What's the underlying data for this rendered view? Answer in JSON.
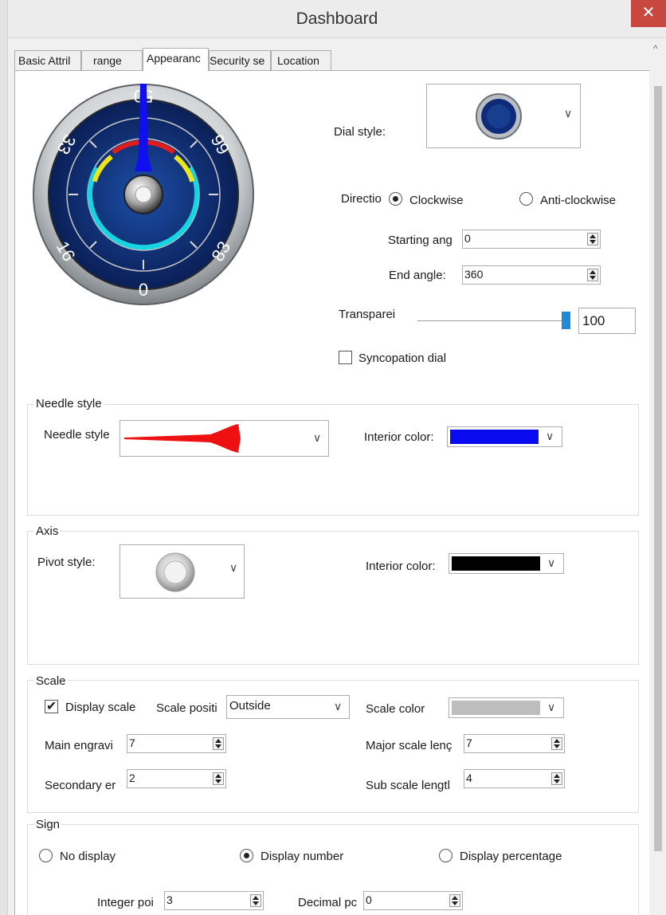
{
  "window": {
    "title": "Dashboard",
    "close_glyph": "✕"
  },
  "tabs": [
    {
      "label": "Basic Attril"
    },
    {
      "label": "range"
    },
    {
      "label": "Appearanc"
    },
    {
      "label": "Security se"
    },
    {
      "label": "Location"
    }
  ],
  "gauge": {
    "labels": [
      "0",
      "16",
      "33",
      "50",
      "66",
      "83"
    ],
    "needle_color": "#1010ee"
  },
  "dial": {
    "label": "Dial style:"
  },
  "direction": {
    "label": "Directio",
    "clockwise": "Clockwise",
    "anticlockwise": "Anti-clockwise",
    "selected": "clockwise"
  },
  "starting_angle": {
    "label": "Starting ang",
    "value": "0"
  },
  "end_angle": {
    "label": "End angle:",
    "value": "360"
  },
  "transparency": {
    "label": "Transparei",
    "value": "100",
    "level": 1.0
  },
  "syncopation": {
    "label": "Syncopation dial",
    "checked": false
  },
  "needle": {
    "group_label": "Needle style",
    "style_label": "Needle style",
    "interior_label": "Interior color:",
    "interior_color": "#0a0aef",
    "needle_color": "#ee1111"
  },
  "axis": {
    "group_label": "Axis",
    "pivot_label": "Pivot style:",
    "interior_label": "Interior color:",
    "interior_color": "#000000"
  },
  "scale": {
    "group_label": "Scale",
    "display_scale": "Display scale",
    "display_checked": true,
    "position_label": "Scale positi",
    "position_value": "Outside",
    "color_label": "Scale color",
    "color_value": "#bdbdbd",
    "main_label": "Main engravi",
    "main_value": "7",
    "major_label": "Major scale lenç",
    "major_value": "7",
    "secondary_label": "Secondary er",
    "secondary_value": "2",
    "sub_label": "Sub scale lengtl",
    "sub_value": "4"
  },
  "sign": {
    "group_label": "Sign",
    "no_display": "No display",
    "display_number": "Display number",
    "display_percentage": "Display percentage",
    "selected": "display_number",
    "integer_label": "Integer poi",
    "integer_value": "3",
    "decimal_label": "Decimal pc",
    "decimal_value": "0"
  }
}
